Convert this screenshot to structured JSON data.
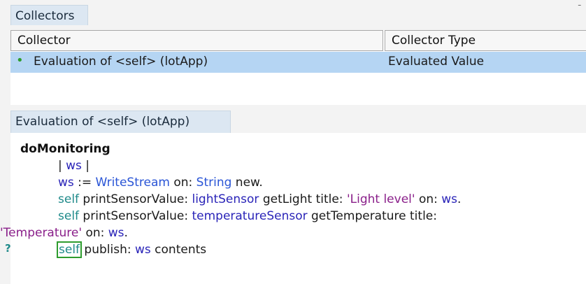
{
  "collectors_pane": {
    "title": "Collectors",
    "menu_glyph": "¯",
    "columns": [
      "Collector",
      "Collector Type"
    ],
    "rows": [
      {
        "bullet": "•",
        "name": "Evaluation of <self> (lotApp)",
        "type": "Evaluated Value"
      }
    ]
  },
  "evaluation_pane": {
    "tab_label": "Evaluation of <self> (lotApp)",
    "gutter_marker": "?",
    "code": {
      "method_name": "doMonitoring",
      "temps": [
        "| ",
        "ws",
        " |"
      ],
      "line2": [
        "ws",
        " := ",
        "WriteStream",
        " on: ",
        "String",
        " new."
      ],
      "line3": [
        "self",
        " printSensorValue: ",
        "lightSensor",
        " getLight title: ",
        "'Light level'",
        " on: ",
        "ws",
        "."
      ],
      "line4": [
        "self",
        " printSensorValue: ",
        "temperatureSensor",
        " getTemperature title:"
      ],
      "line5": [
        "'Temperature'",
        " on: ",
        "ws",
        "."
      ],
      "line6": [
        "self",
        " publish: ",
        "ws",
        " contents"
      ]
    }
  },
  "colors": {
    "variable": "#2a24b8",
    "class_name": "#2a55d6",
    "keyword_self": "#1f8a8a",
    "string_literal": "#8a1f8a",
    "selection_row": "#b5d5f3",
    "cursor_box": "#2e9c2e"
  }
}
